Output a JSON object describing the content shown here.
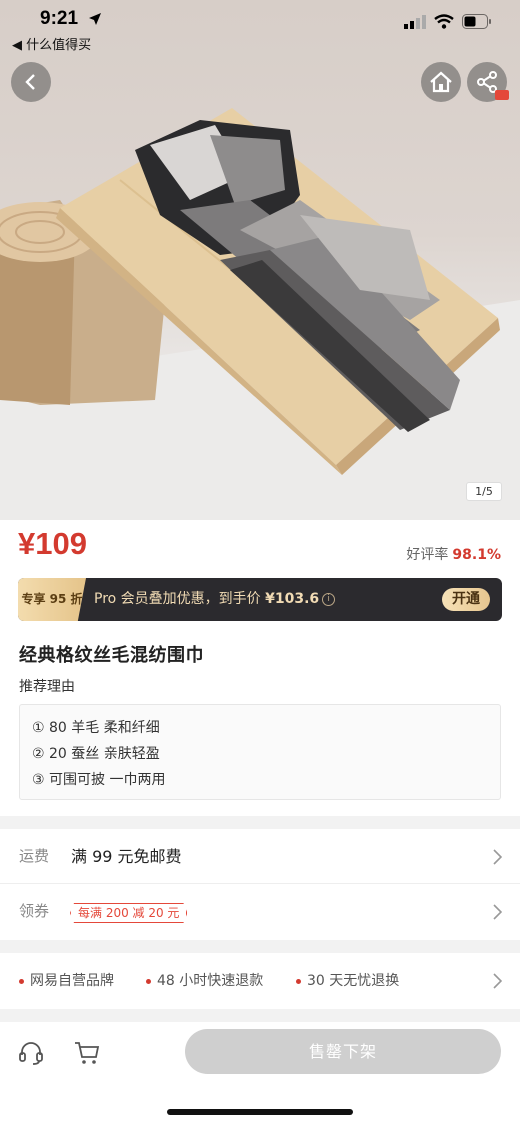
{
  "status_bar": {
    "time": "9:21",
    "back_app": "◀ 什么值得买"
  },
  "gallery": {
    "indicator": "1/5"
  },
  "product": {
    "price": "¥109",
    "rating_label": "好评率",
    "rating_value": "98.1%",
    "pro_tag": "专享 95 折",
    "pro_text": "Pro 会员叠加优惠，到手价",
    "pro_price": "¥103.6",
    "open_button": "开通",
    "title": "经典格纹丝毛混纺围巾",
    "reason_heading": "推荐理由",
    "reasons": [
      "① 80 羊毛 柔和纤细",
      "② 20 蚕丝 亲肤轻盈",
      "③ 可围可披 一巾两用"
    ]
  },
  "shipping": {
    "label": "运费",
    "value": "满 99 元免邮费"
  },
  "coupon": {
    "label": "领券",
    "value": "每满 200 减 20 元"
  },
  "promises": [
    "网易自营品牌",
    "48 小时快速退款",
    "30 天无忧退换"
  ],
  "bottom_bar": {
    "sold_out_label": "售罄下架"
  },
  "colors": {
    "accent_red": "#d33a2f",
    "pro_gold": "#e7c68f",
    "pro_dark": "#2b2a2e",
    "disabled_gray": "#cfcfcf"
  },
  "icons": [
    "back-arrow-icon",
    "home-icon",
    "share-icon",
    "chevron-right-icon",
    "headset-icon",
    "cart-icon",
    "info-icon",
    "location-arrow-icon",
    "signal-icon",
    "wifi-icon",
    "battery-icon"
  ]
}
